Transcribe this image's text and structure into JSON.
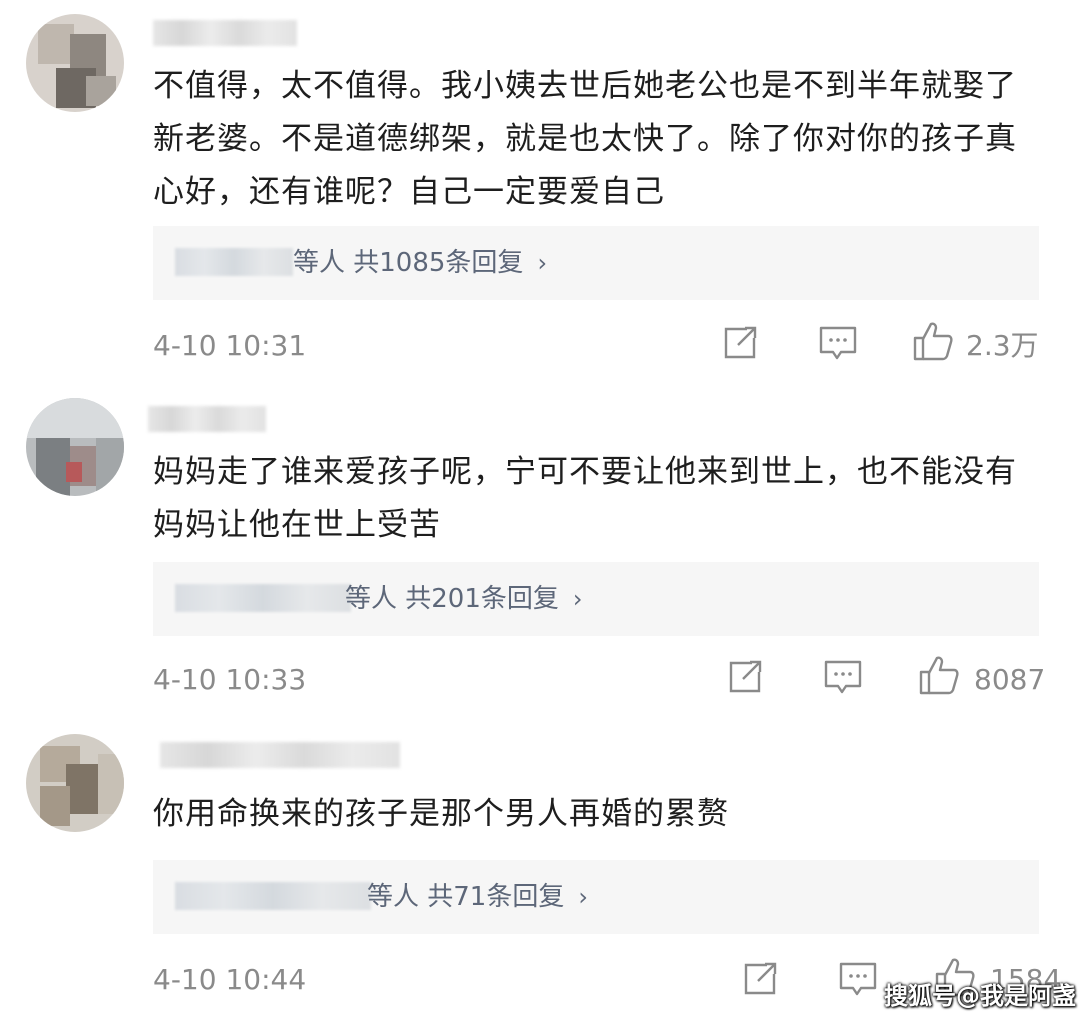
{
  "comments": [
    {
      "text": "不值得，太不值得。我小姨去世后她老公也是不到半年就娶了新老婆。不是道德绑架，就是也太快了。除了你对你的孩子真心好，还有谁呢？自己一定要爱自己",
      "reply_summary": "等人  共1085条回复",
      "time": "4-10 10:31",
      "likes": "2.3万"
    },
    {
      "text": "妈妈走了谁来爱孩子呢，宁可不要让他来到世上，也不能没有妈妈让他在世上受苦",
      "reply_summary": "等人  共201条回复",
      "time": "4-10 10:33",
      "likes": "8087"
    },
    {
      "text": "你用命换来的孩子是那个男人再婚的累赘",
      "reply_summary": "等人  共71条回复",
      "time": "4-10 10:44",
      "likes": "1584"
    }
  ],
  "icons": {
    "share": "share-icon",
    "comment": "comment-icon",
    "like": "thumbs-up-icon",
    "reply_chevron": "chevron-right-icon",
    "chevron_glyph": "›"
  },
  "watermark": "搜狐号@我是阿盏",
  "colors": {
    "text": "#1e1e1e",
    "meta": "#8a8a8a",
    "reply_link": "#5d6779",
    "reply_bg": "#f6f6f6"
  }
}
